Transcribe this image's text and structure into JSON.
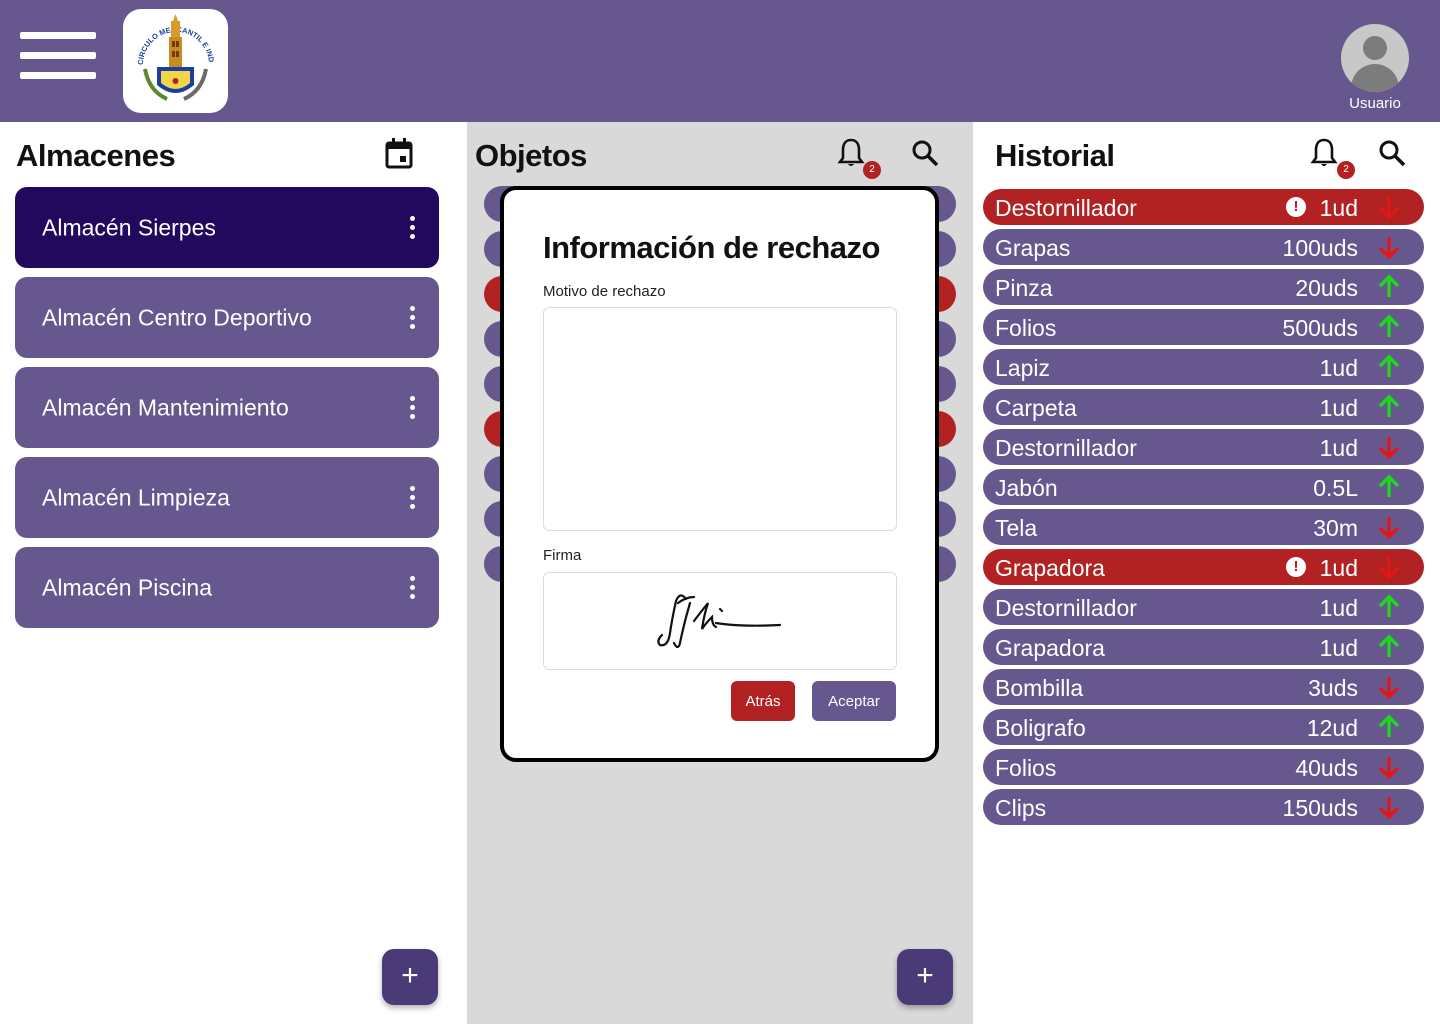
{
  "header": {
    "logo_text": "CIRCULO MERCANTIL E INDUSTRIAL SEVILLA",
    "user_label": "Usuario"
  },
  "almacenes": {
    "title": "Almacenes",
    "items": [
      {
        "label": "Almacén Sierpes",
        "active": true
      },
      {
        "label": "Almacén Centro Deportivo",
        "active": false
      },
      {
        "label": "Almacén Mantenimiento",
        "active": false
      },
      {
        "label": "Almacén Limpieza",
        "active": false
      },
      {
        "label": "Almacén Piscina",
        "active": false
      }
    ],
    "add_label": "+"
  },
  "objetos": {
    "title": "Objetos",
    "notification_count": "2",
    "add_label": "+",
    "background_row_colors": [
      "#67578f",
      "#67578f",
      "#b22222",
      "#67578f",
      "#67578f",
      "#b22222",
      "#67578f",
      "#67578f",
      "#67578f"
    ]
  },
  "historial": {
    "title": "Historial",
    "notification_count": "2",
    "rows": [
      {
        "name": "Destornillador",
        "qty": "1ud",
        "direction": "down",
        "rejected": true
      },
      {
        "name": "Grapas",
        "qty": "100uds",
        "direction": "down",
        "rejected": false
      },
      {
        "name": "Pinza",
        "qty": "20uds",
        "direction": "up",
        "rejected": false
      },
      {
        "name": "Folios",
        "qty": "500uds",
        "direction": "up",
        "rejected": false
      },
      {
        "name": "Lapiz",
        "qty": "1ud",
        "direction": "up",
        "rejected": false
      },
      {
        "name": "Carpeta",
        "qty": "1ud",
        "direction": "up",
        "rejected": false
      },
      {
        "name": "Destornillador",
        "qty": "1ud",
        "direction": "down",
        "rejected": false
      },
      {
        "name": "Jabón",
        "qty": "0.5L",
        "direction": "up",
        "rejected": false
      },
      {
        "name": "Tela",
        "qty": "30m",
        "direction": "down",
        "rejected": false
      },
      {
        "name": "Grapadora",
        "qty": "1ud",
        "direction": "down",
        "rejected": true
      },
      {
        "name": "Destornillador",
        "qty": "1ud",
        "direction": "up",
        "rejected": false
      },
      {
        "name": "Grapadora",
        "qty": "1ud",
        "direction": "up",
        "rejected": false
      },
      {
        "name": "Bombilla",
        "qty": "3uds",
        "direction": "down",
        "rejected": false
      },
      {
        "name": "Boligrafo",
        "qty": "12ud",
        "direction": "up",
        "rejected": false
      },
      {
        "name": "Folios",
        "qty": "40uds",
        "direction": "down",
        "rejected": false
      },
      {
        "name": "Clips",
        "qty": "150uds",
        "direction": "down",
        "rejected": false
      }
    ]
  },
  "modal": {
    "title": "Información de rechazo",
    "reason_label": "Motivo de rechazo",
    "reason_value": "",
    "signature_label": "Firma",
    "back_label": "Atrás",
    "accept_label": "Aceptar"
  },
  "colors": {
    "brand": "#67578f",
    "active": "#22095e",
    "danger": "#b22222",
    "arrow_up": "#1ed71e",
    "arrow_down": "#e01818",
    "mid_panel": "#d9d9d9"
  }
}
